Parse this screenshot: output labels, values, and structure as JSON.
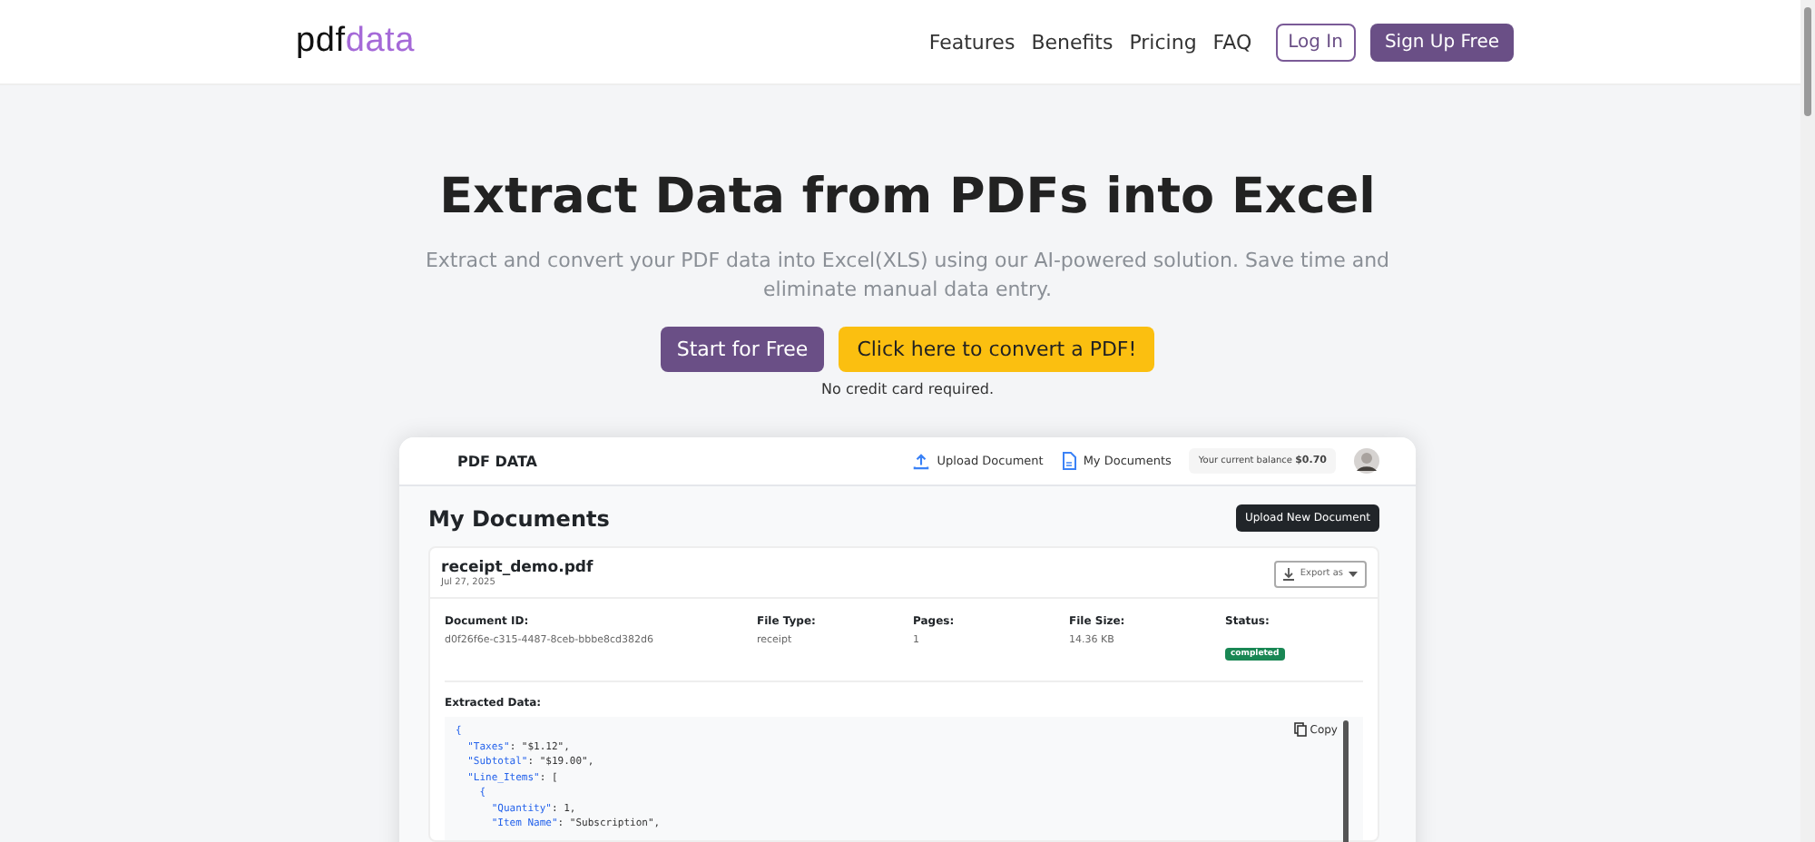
{
  "header": {
    "logo_left": "pdf",
    "logo_right": "data",
    "nav": [
      "Features",
      "Benefits",
      "Pricing",
      "FAQ"
    ],
    "login": "Log In",
    "signup": "Sign Up Free"
  },
  "hero": {
    "title": "Extract Data from PDFs into Excel",
    "subtitle": "Extract and convert your PDF data into Excel(XLS) using our AI-powered solution. Save time and eliminate manual data entry.",
    "primary": "Start for Free",
    "secondary": "Click here to convert a PDF!",
    "note": "No credit card required."
  },
  "app": {
    "brand": "PDF DATA",
    "upload_link": "Upload Document",
    "documents_link": "My Documents",
    "balance_label": "Your current balance",
    "balance": "$0.70",
    "heading": "My Documents",
    "upload_button": "Upload New Document",
    "document": {
      "name": "receipt_demo.pdf",
      "date": "Jul 27, 2025",
      "export": "Export as",
      "fields": [
        {
          "label": "Document ID:",
          "value": "d0f26f6e-c315-4487-8ceb-bbbe8cd382d6"
        },
        {
          "label": "File Type:",
          "value": "receipt"
        },
        {
          "label": "Pages:",
          "value": "1"
        },
        {
          "label": "File Size:",
          "value": "14.36 KB"
        },
        {
          "label": "Status:",
          "value": "completed",
          "kind": "badge"
        }
      ],
      "extracted_label": "Extracted Data:",
      "copy": "Copy",
      "code": [
        {
          "key": "{"
        },
        {
          "key": "  \"Taxes\"",
          "rest": ": \"$1.12\","
        },
        {
          "key": "  \"Subtotal\"",
          "rest": ": \"$19.00\","
        },
        {
          "key": "  \"Line_Items\"",
          "rest": ": ["
        },
        {
          "key": "    {"
        },
        {
          "key": "      \"Quantity\"",
          "rest": ": 1,"
        },
        {
          "key": "      \"Item Name\"",
          "rest": ": \"Subscription\","
        }
      ]
    }
  }
}
